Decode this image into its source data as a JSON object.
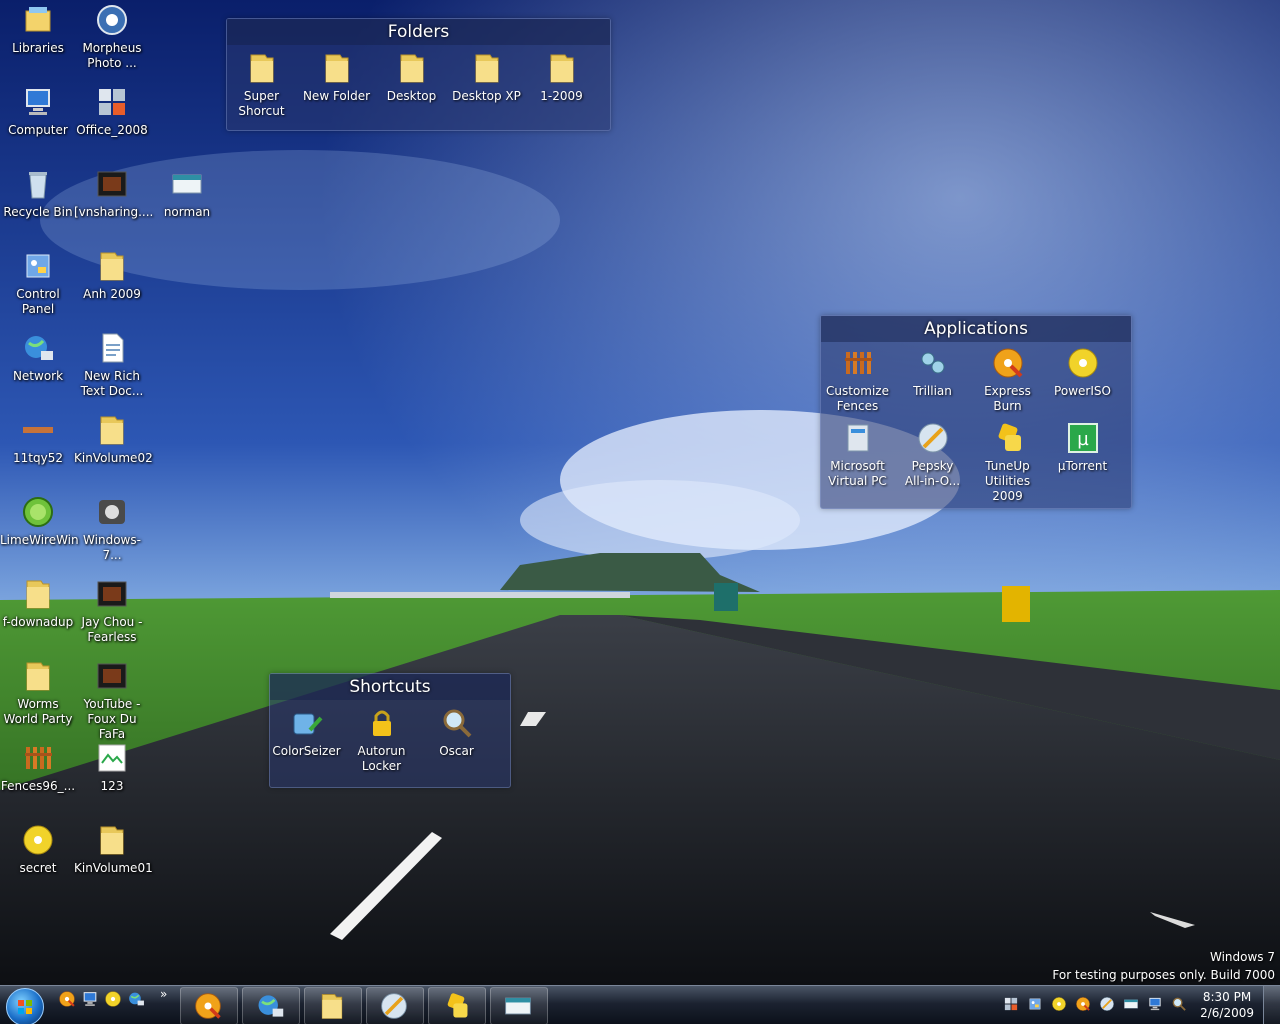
{
  "desktop": {
    "icons": [
      {
        "label": "Libraries",
        "icon": "libraries-icon"
      },
      {
        "label": "Morpheus\nPhoto ...",
        "icon": "morpheus-photo-icon"
      },
      {
        "label": "Computer",
        "icon": "computer-icon"
      },
      {
        "label": "Office_2008",
        "icon": "office-icon"
      },
      {
        "label": "Recycle Bin",
        "icon": "recycle-bin-icon"
      },
      {
        "label": "[vnsharing....",
        "icon": "video-file-icon"
      },
      {
        "label": "norman",
        "icon": "window-app-icon"
      },
      {
        "label": "Control\nPanel",
        "icon": "control-panel-icon"
      },
      {
        "label": "Anh 2009",
        "icon": "folder-icon"
      },
      {
        "label": "Network",
        "icon": "network-icon"
      },
      {
        "label": "New Rich\nText Doc...",
        "icon": "document-icon"
      },
      {
        "label": "11tqy52",
        "icon": "file-strip-icon"
      },
      {
        "label": "KinVolume02",
        "icon": "folder-icon"
      },
      {
        "label": "LimeWireWin",
        "icon": "limewire-icon"
      },
      {
        "label": "Windows-7...",
        "icon": "windows-7-icon"
      },
      {
        "label": "f-downadup",
        "icon": "folder-icon"
      },
      {
        "label": "Jay Chou -\nFearless",
        "icon": "video-file-icon"
      },
      {
        "label": "Worms\nWorld Party",
        "icon": "folder-icon"
      },
      {
        "label": "YouTube -\nFoux Du FaFa",
        "icon": "video-file-icon"
      },
      {
        "label": "Fences96_...",
        "icon": "fences-icon"
      },
      {
        "label": "123",
        "icon": "image-file-icon"
      },
      {
        "label": "secret",
        "icon": "disc-icon"
      },
      {
        "label": "KinVolume01",
        "icon": "folder-icon"
      }
    ]
  },
  "fences": {
    "folders": {
      "title": "Folders",
      "items": [
        {
          "label": "Super\nShorcut",
          "icon": "folder-icon"
        },
        {
          "label": "New Folder",
          "icon": "folder-icon"
        },
        {
          "label": "Desktop",
          "icon": "folder-icon"
        },
        {
          "label": "Desktop XP",
          "icon": "folder-icon"
        },
        {
          "label": "1-2009",
          "icon": "folder-icon"
        }
      ]
    },
    "applications": {
      "title": "Applications",
      "items": [
        {
          "label": "Customize\nFences",
          "icon": "fences-icon"
        },
        {
          "label": "Trillian",
          "icon": "trillian-icon"
        },
        {
          "label": "Express Burn",
          "icon": "express-burn-icon"
        },
        {
          "label": "PowerISO",
          "icon": "disc-icon"
        },
        {
          "label": "Microsoft\nVirtual PC",
          "icon": "virtual-pc-icon"
        },
        {
          "label": "Pepsky\nAll-in-O...",
          "icon": "pepsky-icon"
        },
        {
          "label": "TuneUp\nUtilities 2009",
          "icon": "tuneup-icon"
        },
        {
          "label": "µTorrent",
          "icon": "utorrent-icon"
        }
      ]
    },
    "shortcuts": {
      "title": "Shortcuts",
      "items": [
        {
          "label": "ColorSeizer",
          "icon": "color-seizer-icon"
        },
        {
          "label": "Autorun\nLocker",
          "icon": "lock-icon"
        },
        {
          "label": "Oscar",
          "icon": "magnifier-icon"
        }
      ]
    }
  },
  "watermark": {
    "line1": "Windows 7",
    "line2": "For testing purposes only. Build 7000"
  },
  "taskbar": {
    "quick_launch": [
      "firefox-icon",
      "show-desktop-icon",
      "messenger-icon",
      "internet-explorer-icon"
    ],
    "overflow": "»",
    "buttons": [
      "firefox-icon",
      "internet-explorer-icon",
      "explorer-folder-icon",
      "yahoo-messenger-icon",
      "media-player-icon",
      "snipping-tool-icon"
    ],
    "tray_icons": [
      "tray-app-icon",
      "tray-settings-icon",
      "tray-messenger-icon",
      "tray-security-icon",
      "tray-antivirus-icon",
      "tray-flag-icon",
      "tray-network-icon",
      "tray-volume-icon"
    ],
    "clock": {
      "time": "8:30 PM",
      "date": "2/6/2009"
    }
  },
  "colors": {
    "sky": "#1f3f8f",
    "grass": "#3f8a2a",
    "road": "#22252b",
    "accent": "#1a6fc9"
  }
}
